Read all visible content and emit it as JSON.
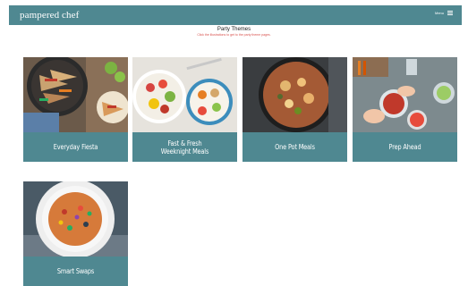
{
  "header": {
    "logo": "pampered chef",
    "menu_label": "Menu"
  },
  "page": {
    "title": "Party Themes",
    "subtitle": "Click the illustrations to get to the party theme pages."
  },
  "cards": [
    {
      "label": "Everyday Fiesta"
    },
    {
      "label": "Fast & Fresh Weeknight Meals"
    },
    {
      "label": "One Pot Meals"
    },
    {
      "label": "Prep Ahead"
    },
    {
      "label": "Smart Swaps"
    }
  ],
  "colors": {
    "header": "#4f8891",
    "card_label_bg": "#4f8891",
    "subtitle": "#d9534f"
  }
}
